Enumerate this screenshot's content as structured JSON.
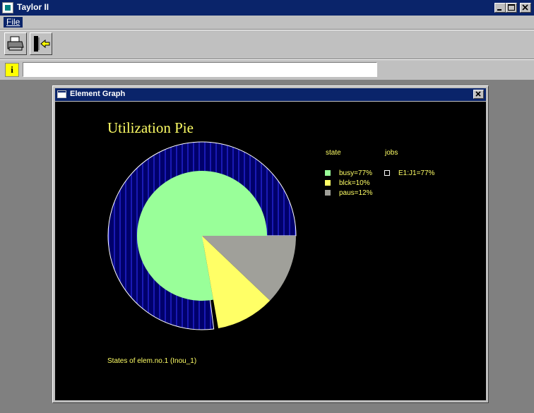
{
  "app": {
    "title": "Taylor II",
    "menu": [
      "File"
    ],
    "window_buttons": [
      "minimize",
      "maximize",
      "close"
    ]
  },
  "toolbar": {
    "buttons": [
      {
        "name": "print",
        "icon": "printer-icon"
      },
      {
        "name": "exit",
        "icon": "exit-door-icon"
      }
    ]
  },
  "infobar": {
    "icon": "info-icon",
    "icon_glyph": "i",
    "value": ""
  },
  "child_window": {
    "title": "Element Graph"
  },
  "chart_data": {
    "type": "pie",
    "title": "Utilization Pie",
    "caption": "States of elem.no.1 (Inou_1)",
    "legend_headers": [
      "state",
      "jobs"
    ],
    "slices": [
      {
        "label": "busy=77%",
        "value": 77,
        "color": "#99ff99"
      },
      {
        "label": "blck=10%",
        "value": 10,
        "color": "#ffff66"
      },
      {
        "label": "paus=12%",
        "value": 12,
        "color": "#a0a09a"
      }
    ],
    "jobs": [
      {
        "label": "E1:J1=77%",
        "value": 77
      }
    ],
    "outer_ring": {
      "value": 77,
      "fill": "#00006b",
      "stripe_color": "#3333ff"
    },
    "colors": {
      "background": "#000000",
      "text": "#ffff66",
      "outline": "#ffffff"
    }
  }
}
